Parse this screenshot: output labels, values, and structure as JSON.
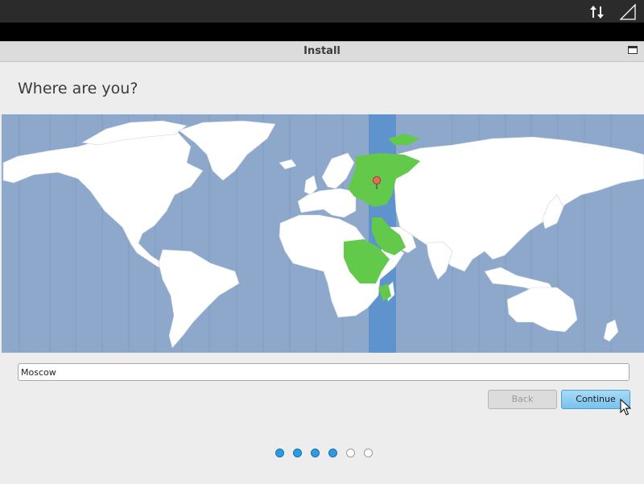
{
  "topbar": {
    "network_icon": "network-transfer-icon",
    "signal_icon": "signal-strength-icon"
  },
  "window": {
    "title": "Install"
  },
  "page": {
    "heading": "Where are you?"
  },
  "map": {
    "selected_timezone_color": "#5f93cd",
    "highlight_region_color": "#63c94a",
    "land_color": "#ffffff",
    "ocean_color": "#8ea8cc",
    "pin_icon": "location-pin-icon"
  },
  "location": {
    "value": "Moscow"
  },
  "buttons": {
    "back_label": "Back",
    "continue_label": "Continue",
    "back_disabled": true
  },
  "progress": {
    "steps": [
      true,
      true,
      true,
      true,
      false,
      false
    ]
  },
  "colors": {
    "accent": "#79c1ec",
    "step_active": "#2d9be3"
  }
}
